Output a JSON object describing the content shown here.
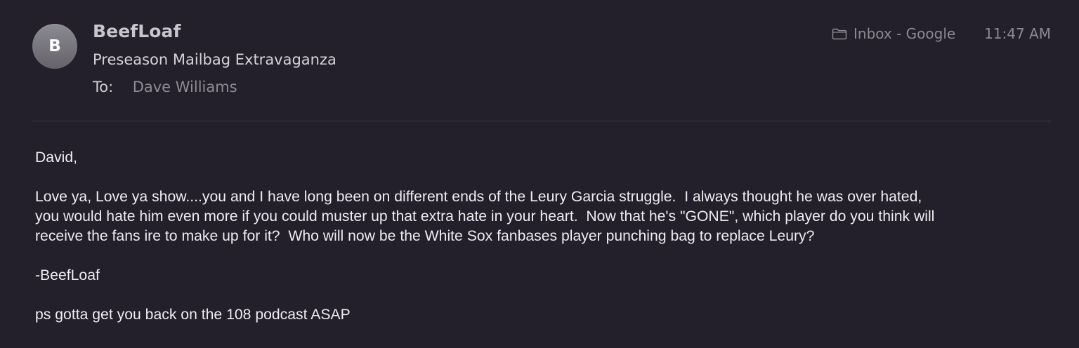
{
  "message": {
    "avatar_initial": "B",
    "sender": "BeefLoaf",
    "subject": "Preseason Mailbag Extravaganza",
    "to_label": "To:",
    "to_value": "Dave Williams",
    "mailbox": "Inbox - Google",
    "mailbox_icon": "folder-icon",
    "time": "11:47 AM",
    "body": {
      "greeting": "David,",
      "paragraph_lines": [
        "Love ya, Love ya show....you and I have long been on different ends of the Leury Garcia struggle.  I always thought he was over hated,",
        "you would hate him even more if you could muster up that extra hate in your heart.  Now that he's \"GONE\", which player do you think will",
        "receive the fans ire to make up for it?  Who will now be the White Sox fanbases player punching bag to replace Leury?"
      ],
      "signature": "-BeefLoaf",
      "postscript": "ps gotta get you back on the 108 podcast ASAP"
    }
  },
  "colors": {
    "background": "#231f2b",
    "primary_text": "#eeedf0",
    "secondary_text": "#8c8992",
    "avatar": "#7a787e"
  }
}
